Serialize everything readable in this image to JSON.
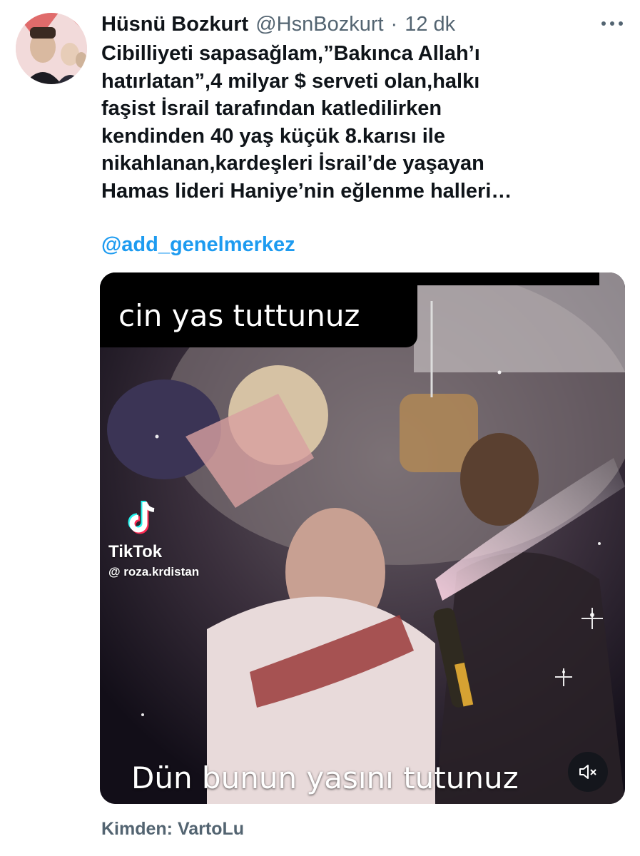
{
  "author": {
    "display_name": "Hüsnü Bozkurt",
    "handle": "@HsnBozkurt",
    "separator": "·",
    "time": "12 dk"
  },
  "tweet": {
    "text": "Cibilliyeti sapasağlam,”Bakınca Allah’ı\nhatırlatan”,4 milyar $ serveti olan,halkı\nfaşist İsrail tarafından katledilirken\nkendinden 40 yaş küçük 8.karısı ile\nnikahlanan,kardeşleri İsrail’de yaşayan\nHamas lideri Haniye’nin eğlenme halleri…",
    "mention": "@add_genelmerkez"
  },
  "media": {
    "caption_top": "cin yas tuttunuz",
    "caption_bottom": "Dün bunun yasını tutunuz",
    "watermark_brand": "TikTok",
    "watermark_user": "@ roza.krdistan",
    "mute_icon": "speaker-muted-icon"
  },
  "source": {
    "label": "Kimden: VartoLu"
  },
  "colors": {
    "text": "#0f1419",
    "secondary": "#536471",
    "link": "#1d9bf0"
  }
}
